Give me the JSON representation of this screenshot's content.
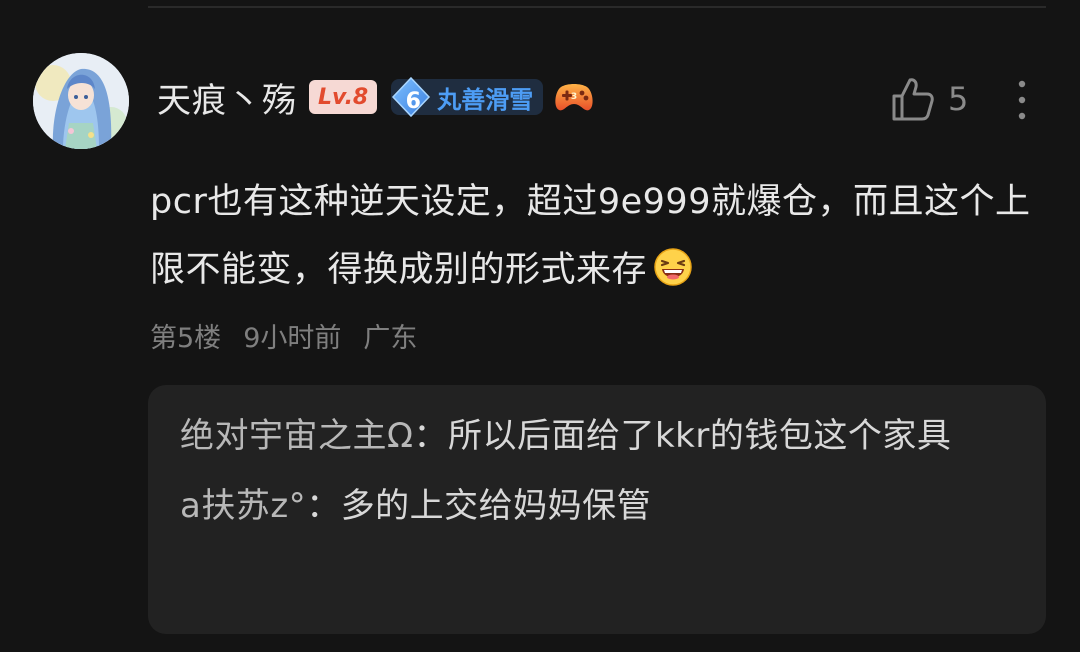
{
  "comment": {
    "username": "天痕丶殇",
    "level_badge": "Lv.8",
    "fan_badge": {
      "level": "6",
      "name": "丸善滑雪"
    },
    "decoration_icon": "gamepad-icon",
    "like_icon": "thumbs-up-icon",
    "like_count": "5",
    "more_icon": "more-vertical-icon",
    "text": "pcr也有这种逆天设定，超过9e999就爆仓，而且这个上限不能变，得换成别的形式来存",
    "emoji": "laughing-face-emoji",
    "meta": {
      "floor": "第5楼",
      "time": "9小时前",
      "location": "广东"
    }
  },
  "sub_replies": [
    {
      "author": "绝对宇宙之主Ω",
      "separator": "：",
      "text": "所以后面给了kkr的钱包这个家具"
    },
    {
      "author": "a扶苏z°",
      "separator": "：",
      "text": "多的上交给妈妈保管"
    }
  ],
  "colors": {
    "background": "#141414",
    "level_badge_bg": "#f6d9d4",
    "level_badge_text": "#e24b2e",
    "fan_badge_accent": "#4d9df5",
    "sub_reply_bg": "#222222"
  }
}
